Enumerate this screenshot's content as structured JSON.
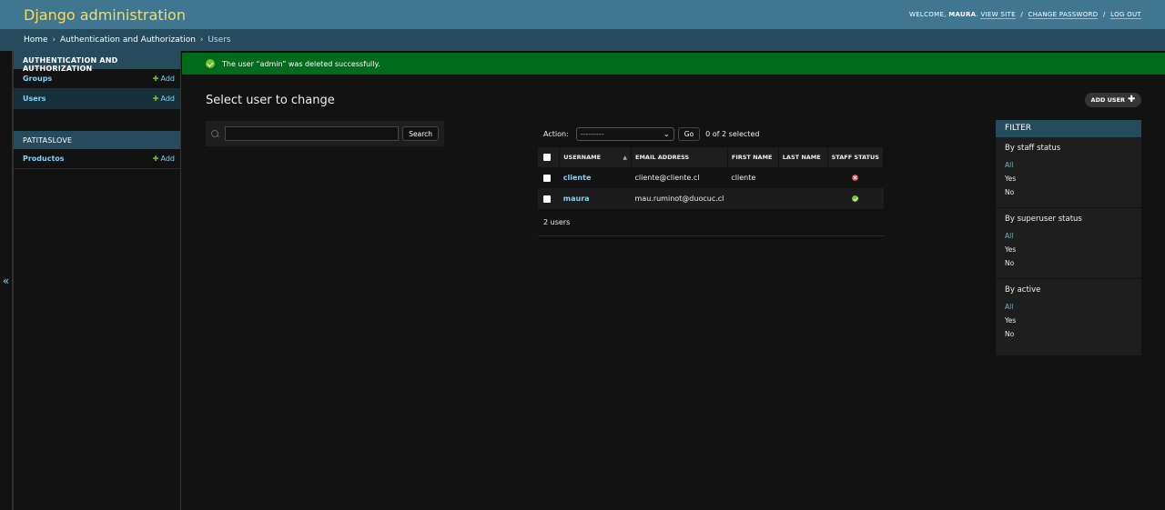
{
  "header": {
    "branding": "Django administration",
    "welcome": "Welcome,",
    "username": "Maura",
    "view_site": "View site",
    "change_password": "Change password",
    "log_out": "Log out",
    "sep": "/"
  },
  "breadcrumbs": {
    "home": "Home",
    "app": "Authentication and Authorization",
    "current": "Users",
    "sep": "›"
  },
  "sidebar": {
    "toggle": "«",
    "apps": [
      {
        "caption": "Authentication and Authorization",
        "models": [
          {
            "label": "Groups",
            "add": "Add"
          },
          {
            "label": "Users",
            "add": "Add"
          }
        ]
      },
      {
        "caption": "PATITASLOVE",
        "models": [
          {
            "label": "Productos",
            "add": "Add"
          }
        ]
      }
    ]
  },
  "messages": {
    "success": "The user “admin” was deleted successfully."
  },
  "content": {
    "title": "Select user to change",
    "add_user": "Add user",
    "search_button": "Search",
    "search_value": "",
    "action_label": "Action:",
    "action_selected": "---------",
    "go_button": "Go",
    "selection_counter": "0 of 2 selected",
    "paginator": "2 users"
  },
  "table": {
    "headers": [
      "Username",
      "Email address",
      "First name",
      "Last name",
      "Staff status"
    ],
    "rows": [
      {
        "username": "cliente",
        "email": "cliente@cliente.cl",
        "first_name": "cliente",
        "last_name": "",
        "staff_status": false
      },
      {
        "username": "maura",
        "email": "mau.ruminot@duocuc.cl",
        "first_name": "",
        "last_name": "",
        "staff_status": true
      }
    ]
  },
  "filter": {
    "title": "Filter",
    "groups": [
      {
        "title": "By staff status",
        "options": [
          "All",
          "Yes",
          "No"
        ]
      },
      {
        "title": "By superuser status",
        "options": [
          "All",
          "Yes",
          "No"
        ]
      },
      {
        "title": "By active",
        "options": [
          "All",
          "Yes",
          "No"
        ]
      }
    ]
  },
  "colors": {
    "header_bg": "#417690",
    "branding": "#f5dd5d",
    "breadcrumbs_bg": "#264b5d",
    "success_bg": "#006b1b",
    "link": "#81d4fa",
    "add_plus": "#70bf2b",
    "error_icon": "#dd4646",
    "page_bg": "#121212"
  }
}
